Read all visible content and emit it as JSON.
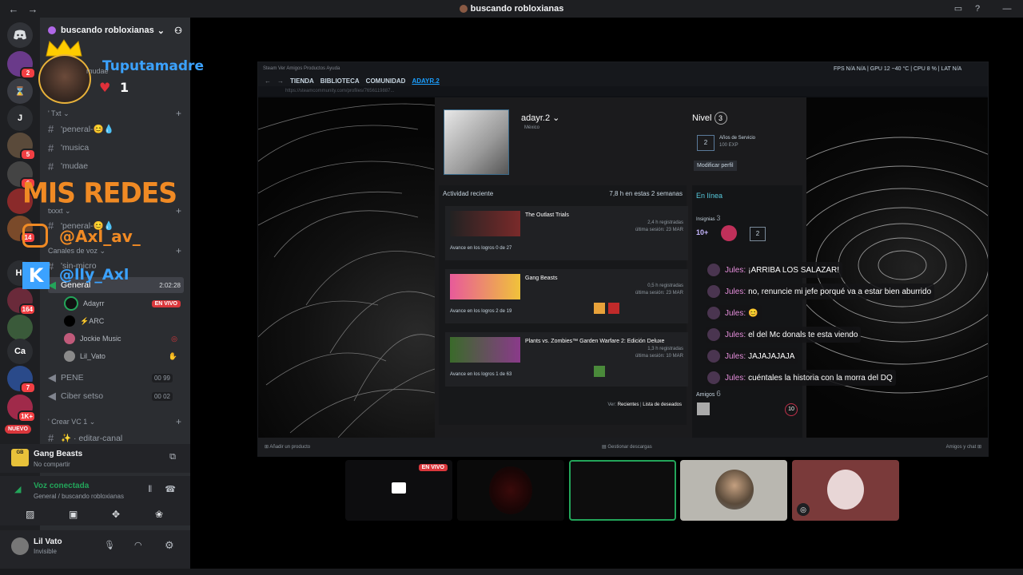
{
  "window": {
    "title": "buscando robloxianas",
    "back": "←",
    "forward": "→"
  },
  "server": {
    "name": "buscando robloxianas"
  },
  "guild_badges": {
    "b1": "2",
    "b2": "5",
    "b3": "6",
    "b4": "14",
    "b5": "164",
    "b6": "7",
    "b7": "1K+",
    "new": "NUEVO"
  },
  "guild_labels": {
    "j": "J",
    "hi": "Hi",
    "ca": "Ca"
  },
  "categories": {
    "txt": "' Txt",
    "txxxt": "txxxt",
    "voice": "Canales de voz",
    "crear": "' Crear VC 1"
  },
  "channels": {
    "general": "'peneral-😊💧",
    "musica": "'musica",
    "mudae": "'mudae",
    "general2": "'peneral-😊💧",
    "sinmicro": "'sin-micro",
    "voice_general": "General",
    "voice_general_time": "2:02:28",
    "pene": "PENE",
    "pene_count": "00",
    "pene_max": "99",
    "ciber": "Ciber setso",
    "ciber_count": "00",
    "ciber_max": "02",
    "editar": "✨ · editar-canal"
  },
  "voice_users": [
    {
      "name": "Adayrr",
      "live": "EN VIVO"
    },
    {
      "name": "⚡ARC"
    },
    {
      "name": "Jockie Music"
    },
    {
      "name": "Lil_Vato"
    }
  ],
  "activity": {
    "game": "Gang Beasts",
    "sub": "No compartir"
  },
  "voice": {
    "status": "Voz conectada",
    "where": "General / buscando robloxianas"
  },
  "user": {
    "name": "Lil Vato",
    "status": "Invisible"
  },
  "overlay": {
    "nickname": "Tuputamadre",
    "hearts": "1",
    "muted": "mudae",
    "redes": "MIS REDES",
    "ig": "@Axl_av_",
    "kick": "@lly_Axl"
  },
  "steam": {
    "topbar": "Steam  Ver  Amigos  Productos  Ayuda",
    "tabs": [
      "TIENDA",
      "BIBLIOTECA",
      "COMUNIDAD",
      "ADAYR.2"
    ],
    "url": "https://steamcommunity.com/profiles/7656119887...",
    "stats": "FPS  N/A  N/A  |  GPU 12 ~40 °C  |  CPU 8 %  |  LAT N/A",
    "username": "adayr.2",
    "country": "México",
    "level_label": "Nivel",
    "level": "3",
    "years": "2",
    "years_text": "Años de Servicio",
    "exp": "100 EXP",
    "edit": "Modificar perfil",
    "recent": "Actividad reciente",
    "hours": "7,8 h en estas 2 semanas",
    "online": "En línea",
    "badges_label": "Insignias",
    "badges_count": "3",
    "friends_label": "Amigos",
    "friends_count": "6",
    "friend_level": "10",
    "view": "Ver:",
    "view_recent": "Recientes",
    "view_wish": "Lista de deseados",
    "add_product": "Añadir un producto",
    "downloads": "Gestionar descargas",
    "friends_chat": "Amigos y chat",
    "games": [
      {
        "name": "The Outlast Trials",
        "hours": "2,4 h registradas",
        "last": "última sesión: 23 MAR",
        "progress": "Avance en los logros  0 de 27"
      },
      {
        "name": "Gang Beasts",
        "hours": "0,5 h registradas",
        "last": "última sesión: 23 MAR",
        "progress": "Avance en los logros  2 de 19"
      },
      {
        "name": "Plants vs. Zombies™ Garden Warfare 2: Edición Deluxe",
        "hours": "1,3 h registradas",
        "last": "última sesión: 10 MAR",
        "progress": "Avance en los logros  1 de 63"
      }
    ]
  },
  "chat": [
    {
      "name": "Jules:",
      "msg": "¡ARRIBA LOS SALAZAR!"
    },
    {
      "name": "Jules:",
      "msg": "no, renuncie mi jefe porqué va a estar bien aburrido"
    },
    {
      "name": "Jules:",
      "msg": "😊"
    },
    {
      "name": "Jules:",
      "msg": "el del Mc donals te esta viendo"
    },
    {
      "name": "Jules:",
      "msg": "JAJAJAJAJA"
    },
    {
      "name": "Jules:",
      "msg": "cuéntales la historia con la morra del DQ"
    }
  ],
  "tiles": {
    "live": "EN VIVO"
  },
  "colors": {
    "accent": "#5865f2",
    "live": "#da373c",
    "online": "#23a55a",
    "overlay_orange": "#f08a24",
    "overlay_blue": "#3ba2ff"
  },
  "icons": [
    "discord-icon",
    "crown-icon",
    "heart-icon",
    "instagram-icon",
    "kick-icon",
    "mic-icon",
    "headphones-icon",
    "gear-icon",
    "hangup-icon"
  ]
}
